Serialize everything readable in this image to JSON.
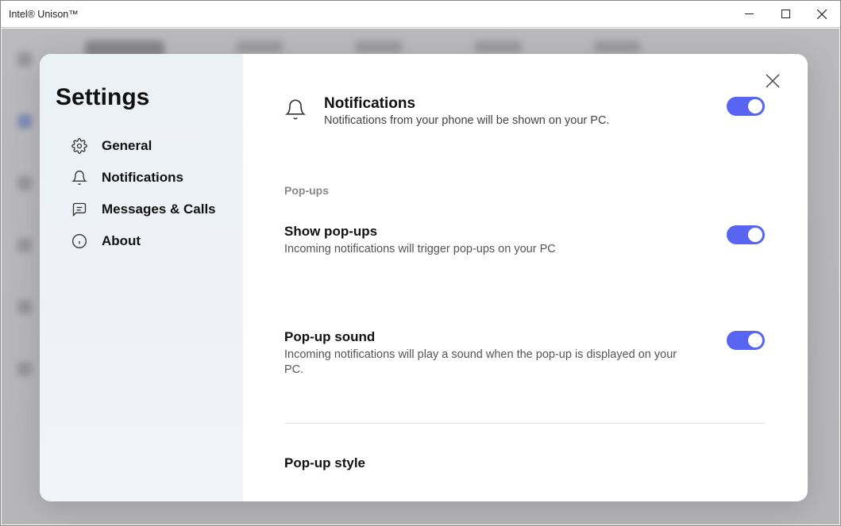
{
  "window": {
    "title": "Intel® Unison™"
  },
  "sidebar": {
    "title": "Settings",
    "items": [
      {
        "label": "General",
        "icon": "gear-icon"
      },
      {
        "label": "Notifications",
        "icon": "bell-icon"
      },
      {
        "label": "Messages & Calls",
        "icon": "message-icon"
      },
      {
        "label": "About",
        "icon": "info-icon"
      }
    ]
  },
  "panel": {
    "header": {
      "title": "Notifications",
      "desc": "Notifications from your phone will be shown on your PC.",
      "toggle": true
    },
    "section_label": "Pop-ups",
    "settings": [
      {
        "title": "Show pop-ups",
        "desc": "Incoming notifications will trigger pop-ups on your PC",
        "toggle": true
      },
      {
        "title": "Pop-up sound",
        "desc": "Incoming notifications will play a sound when the pop-up is displayed on your PC.",
        "toggle": true
      }
    ],
    "style_title": "Pop-up style"
  },
  "colors": {
    "accent": "#5865f2"
  }
}
